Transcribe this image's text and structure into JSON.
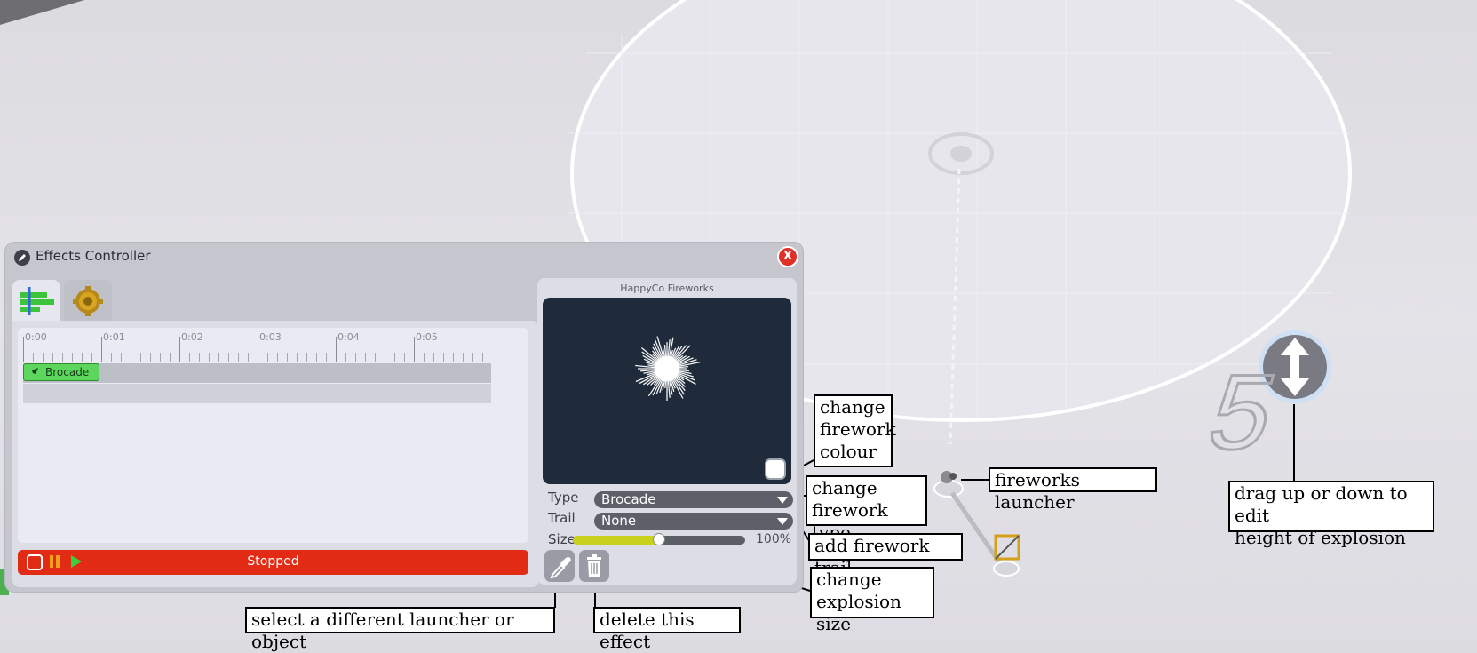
{
  "window": {
    "title": "Effects Controller",
    "close_label": "X"
  },
  "tabs": [
    {
      "name": "timeline-icon"
    },
    {
      "name": "gear-icon"
    }
  ],
  "timeline": {
    "ticks": [
      "0:00",
      "0:01",
      "0:02",
      "0:03",
      "0:04",
      "0:05"
    ],
    "effect_block_label": "Brocade"
  },
  "status": {
    "text": "Stopped"
  },
  "preview": {
    "title": "HappyCo Fireworks"
  },
  "controls": {
    "type_label": "Type",
    "type_value": "Brocade",
    "trail_label": "Trail",
    "trail_value": "None",
    "size_label": "Size",
    "size_value_text": "100%",
    "size_slider_fraction": 0.5
  },
  "scene": {
    "height_digit": "5"
  },
  "callouts": {
    "change_colour": "change\nfirework\ncolour",
    "change_type": "change\nfirework type",
    "add_trail": "add firework trail",
    "change_size": "change\nexplosion size",
    "select_launcher": "select a different launcher or object",
    "delete_effect": "delete this effect",
    "fireworks_launcher": "fireworks launcher",
    "drag_height": "drag up or down to edit\nheight of explosion"
  },
  "colors": {
    "status_bar": "#e12b14",
    "effect_block": "#5cd65c",
    "size_fill": "#c8d21c",
    "close_button": "#e0302a",
    "preview_bg": "#1f2a3a"
  }
}
